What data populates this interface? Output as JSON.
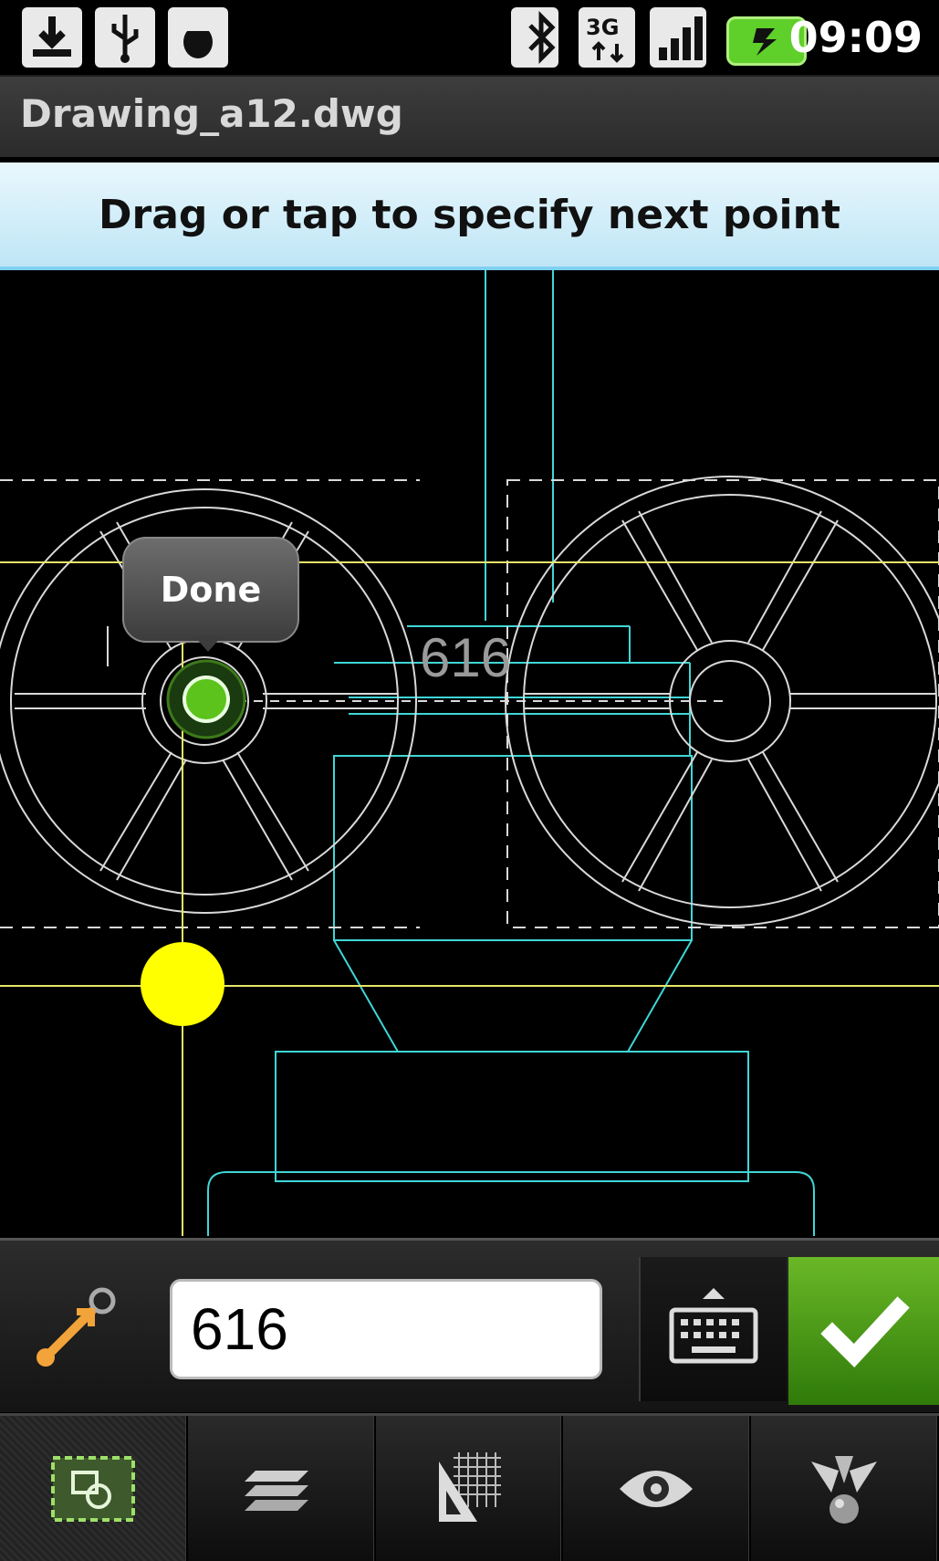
{
  "status_bar": {
    "left_icons": [
      "download-icon",
      "usb-icon",
      "android-debug-icon"
    ],
    "right_icons": [
      "bluetooth-icon",
      "3g-data-icon",
      "signal-icon",
      "battery-charging-icon"
    ],
    "time": "09:09"
  },
  "title_bar": {
    "file_name": "Drawing_a12.dwg"
  },
  "prompt": {
    "text": "Drag or tap to specify next point"
  },
  "canvas": {
    "tooltip_label": "Done",
    "dimension_label": "616",
    "colors": {
      "background": "#000000",
      "cyan_lines": "#3fd6d6",
      "yellow_lines": "#e6e66a",
      "white_lines": "#d9d9d9",
      "snap_point": "#ffff00",
      "active_point": "#5cc21c"
    }
  },
  "input_bar": {
    "value": "616",
    "icons": {
      "dimension": "dimension-line-icon",
      "keyboard": "keyboard-icon",
      "confirm": "checkmark-icon"
    },
    "confirm_color": "#4f9b1a"
  },
  "toolbar": {
    "items": [
      {
        "icon": "select-icon",
        "active": true
      },
      {
        "icon": "layers-icon",
        "active": false
      },
      {
        "icon": "grid-ruler-icon",
        "active": false
      },
      {
        "icon": "eye-icon",
        "active": false
      },
      {
        "icon": "snap-icon",
        "active": false
      }
    ]
  }
}
